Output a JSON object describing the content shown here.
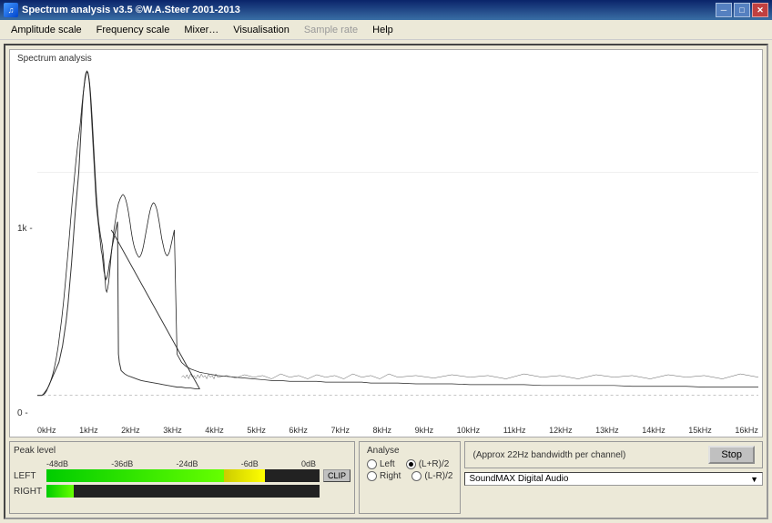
{
  "titlebar": {
    "icon": "♫",
    "title": "Spectrum analysis v3.5  ©W.A.Steer 2001-2013",
    "minimize": "─",
    "maximize": "□",
    "close": "✕"
  },
  "menu": {
    "items": [
      {
        "label": "Amplitude scale",
        "disabled": false
      },
      {
        "label": "Frequency scale",
        "disabled": false
      },
      {
        "label": "Mixer…",
        "disabled": false
      },
      {
        "label": "Visualisation",
        "disabled": false
      },
      {
        "label": "Sample rate",
        "disabled": true
      },
      {
        "label": "Help",
        "disabled": false
      }
    ]
  },
  "spectrum": {
    "title": "Spectrum analysis",
    "y_label_1k": "1k -",
    "y_label_0": "0 -",
    "x_labels": [
      "0kHz",
      "1kHz",
      "2kHz",
      "3kHz",
      "4kHz",
      "5kHz",
      "6kHz",
      "7kHz",
      "8kHz",
      "9kHz",
      "10kHz",
      "11kHz",
      "12kHz",
      "13kHz",
      "14kHz",
      "15kHz",
      "16kHz"
    ]
  },
  "peak_level": {
    "title": "Peak level",
    "channels": [
      {
        "label": "LEFT",
        "green_pct": 65,
        "yellow_pct": 15,
        "red_pct": 0
      },
      {
        "label": "RIGHT",
        "green_pct": 10,
        "yellow_pct": 0,
        "red_pct": 0
      }
    ],
    "markers": [
      "-48dB",
      "-36dB",
      "-24dB",
      "-6dB",
      "0dB"
    ],
    "clip_label": "CLIP"
  },
  "analyse": {
    "title": "Analyse",
    "options": [
      {
        "label": "Left",
        "selected": false
      },
      {
        "label": "(L+R)/2",
        "selected": true
      },
      {
        "label": "Right",
        "selected": false
      },
      {
        "label": "(L-R)/2",
        "selected": false
      }
    ]
  },
  "info": {
    "bandwidth": "(Approx 22Hz bandwidth per channel)",
    "stop_label": "Stop",
    "device": "SoundMAX Digital Audio"
  }
}
